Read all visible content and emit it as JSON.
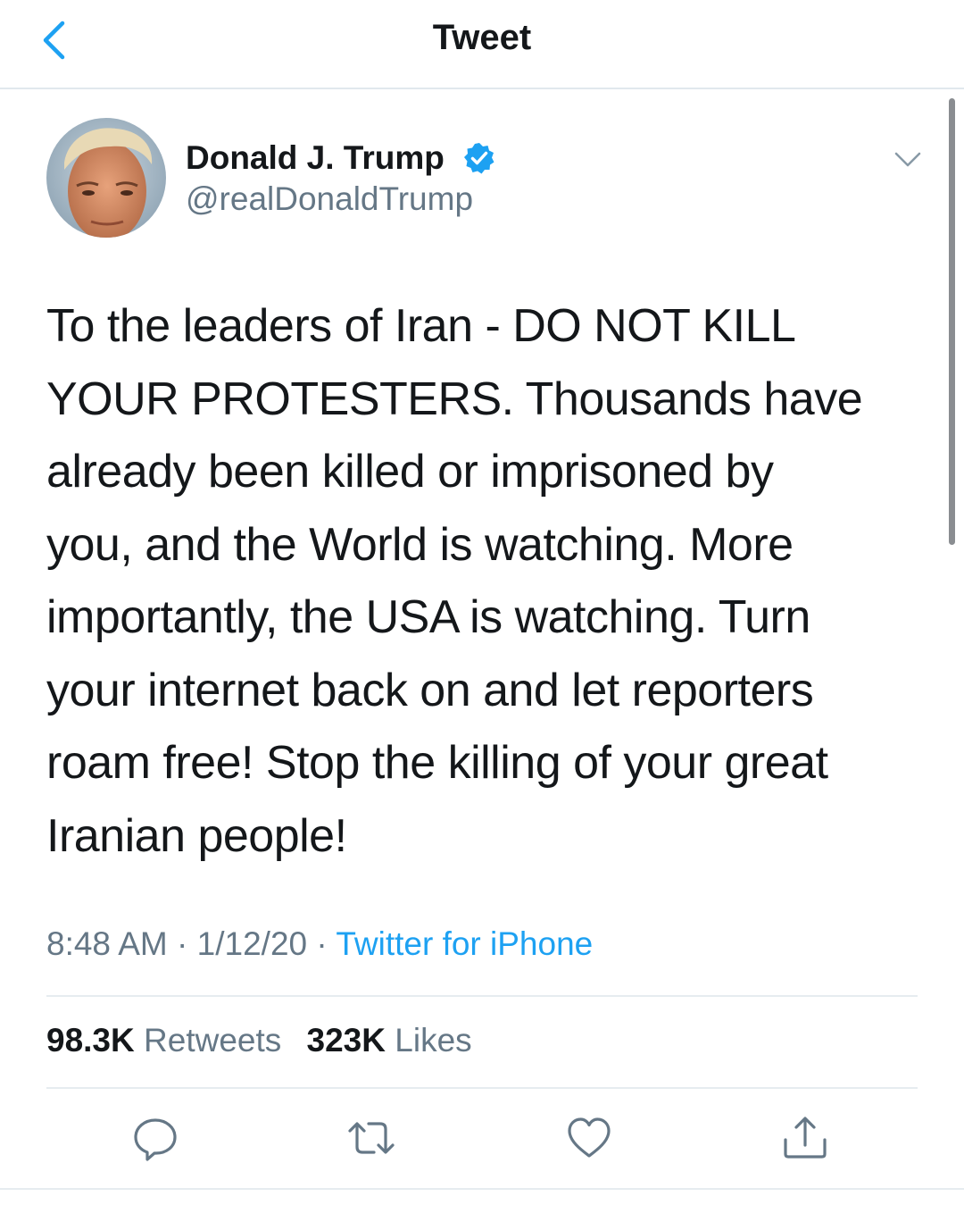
{
  "header": {
    "title": "Tweet"
  },
  "author": {
    "name": "Donald J. Trump",
    "handle": "@realDonaldTrump",
    "verified": true
  },
  "tweet": {
    "lines": [
      "To the leaders of Iran - DO NOT KILL",
      "YOUR PROTESTERS. Thousands have",
      "already been killed or imprisoned by",
      "you, and the World is watching. More",
      "importantly, the USA is watching. Turn",
      "your internet back on and let reporters",
      "roam free! Stop the killing of your great",
      "Iranian people!"
    ]
  },
  "meta": {
    "time": "8:48 AM",
    "separator": " · ",
    "date": "1/12/20",
    "source": "Twitter for iPhone"
  },
  "stats": {
    "retweets_count": "98.3K",
    "retweets_label": "Retweets",
    "likes_count": "323K",
    "likes_label": "Likes"
  },
  "icons": {
    "back": "chevron-left-icon",
    "verified": "verified-badge-icon",
    "more": "chevron-down-icon",
    "reply": "reply-icon",
    "retweet": "retweet-icon",
    "like": "heart-icon",
    "share": "share-icon"
  },
  "colors": {
    "accent": "#1da1f2",
    "text": "#14171a",
    "secondary": "#657786"
  }
}
